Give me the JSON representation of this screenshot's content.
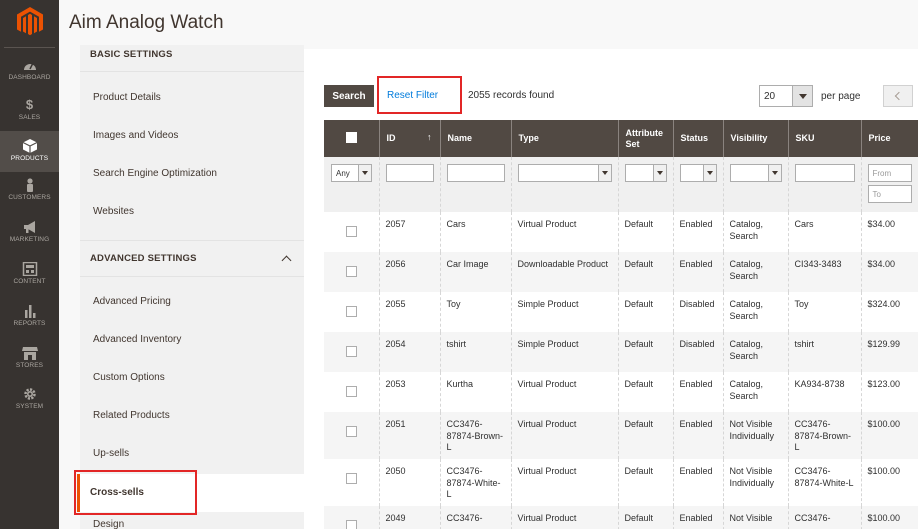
{
  "page_title": "Aim Analog Watch",
  "adminnav": {
    "items": [
      {
        "label": "DASHBOARD",
        "icon": "dashboard-icon"
      },
      {
        "label": "SALES",
        "icon": "dollar-icon"
      },
      {
        "label": "PRODUCTS",
        "icon": "cube-icon"
      },
      {
        "label": "CUSTOMERS",
        "icon": "person-icon"
      },
      {
        "label": "MARKETING",
        "icon": "megaphone-icon"
      },
      {
        "label": "CONTENT",
        "icon": "layout-icon"
      },
      {
        "label": "REPORTS",
        "icon": "bar-chart-icon"
      },
      {
        "label": "STORES",
        "icon": "store-icon"
      },
      {
        "label": "SYSTEM",
        "icon": "gear-icon"
      }
    ]
  },
  "section_nav": {
    "basic_heading": "BASIC SETTINGS",
    "basic_items": [
      "Product Details",
      "Images and Videos",
      "Search Engine Optimization",
      "Websites"
    ],
    "advanced_heading": "ADVANCED SETTINGS",
    "advanced_items": [
      "Advanced Pricing",
      "Advanced Inventory",
      "Custom Options",
      "Related Products",
      "Up-sells",
      "Cross-sells",
      "Design"
    ]
  },
  "toolbar": {
    "search_label": "Search",
    "reset_label": "Reset Filter",
    "records_text": "2055 records found",
    "per_page_value": "20",
    "per_page_label": "per page"
  },
  "grid": {
    "columns": [
      "ID",
      "Name",
      "Type",
      "Attribute Set",
      "Status",
      "Visibility",
      "SKU",
      "Price"
    ],
    "filters": {
      "any": "Any",
      "price_from": "From",
      "price_to": "To"
    },
    "rows": [
      {
        "id": "2057",
        "name": "Cars",
        "type": "Virtual Product",
        "attribute_set": "Default",
        "status": "Enabled",
        "visibility": "Catalog, Search",
        "sku": "Cars",
        "price": "$34.00"
      },
      {
        "id": "2056",
        "name": "Car Image",
        "type": "Downloadable Product",
        "attribute_set": "Default",
        "status": "Enabled",
        "visibility": "Catalog, Search",
        "sku": "CI343-3483",
        "price": "$34.00"
      },
      {
        "id": "2055",
        "name": "Toy",
        "type": "Simple Product",
        "attribute_set": "Default",
        "status": "Disabled",
        "visibility": "Catalog, Search",
        "sku": "Toy",
        "price": "$324.00"
      },
      {
        "id": "2054",
        "name": "tshirt",
        "type": "Simple Product",
        "attribute_set": "Default",
        "status": "Disabled",
        "visibility": "Catalog, Search",
        "sku": "tshirt",
        "price": "$129.99"
      },
      {
        "id": "2053",
        "name": "Kurtha",
        "type": "Virtual Product",
        "attribute_set": "Default",
        "status": "Enabled",
        "visibility": "Catalog, Search",
        "sku": "KA934-8738",
        "price": "$123.00"
      },
      {
        "id": "2051",
        "name": "CC3476-87874-Brown-L",
        "type": "Virtual Product",
        "attribute_set": "Default",
        "status": "Enabled",
        "visibility": "Not Visible Individually",
        "sku": "CC3476-87874-Brown-L",
        "price": "$100.00"
      },
      {
        "id": "2050",
        "name": "CC3476-87874-White-L",
        "type": "Virtual Product",
        "attribute_set": "Default",
        "status": "Enabled",
        "visibility": "Not Visible Individually",
        "sku": "CC3476-87874-White-L",
        "price": "$100.00"
      },
      {
        "id": "2049",
        "name": "CC3476-",
        "type": "Virtual Product",
        "attribute_set": "Default",
        "status": "Enabled",
        "visibility": "Not Visible",
        "sku": "CC3476-",
        "price": "$100.00"
      }
    ]
  },
  "colors": {
    "nav_bg": "#373330",
    "header_bg": "#514943",
    "accent": "#eb5202",
    "link": "#007bdb",
    "highlight": "#e22626"
  }
}
